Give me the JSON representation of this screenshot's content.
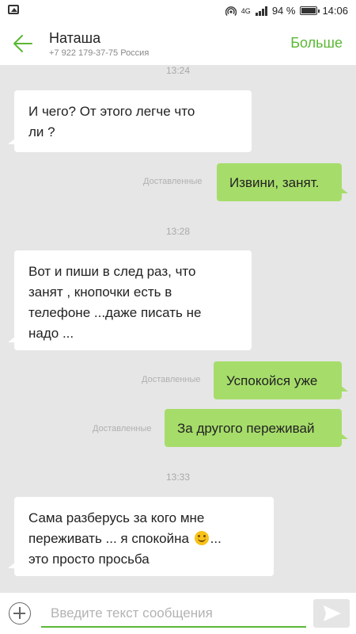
{
  "status_bar": {
    "network": "4G",
    "battery_text": "94 %",
    "time": "14:06"
  },
  "header": {
    "name": "Наташа",
    "subtitle": "+7 922 179-37-75 Россия",
    "more_label": "Больше"
  },
  "messages": [
    {
      "type": "time",
      "text": "13:24"
    },
    {
      "type": "incoming",
      "lines": [
        "И чего? От этого легче что",
        "ли ?"
      ]
    },
    {
      "type": "outgoing",
      "text": "Извини, занят.",
      "status": "Доставленные"
    },
    {
      "type": "time",
      "text": "13:28"
    },
    {
      "type": "incoming",
      "lines": [
        "Вот и пиши в след раз, что",
        "занят , кнопочки есть в",
        "телефоне ...даже писать не",
        "надо ..."
      ]
    },
    {
      "type": "outgoing",
      "text": "Успокойся уже",
      "status": "Доставленные"
    },
    {
      "type": "outgoing",
      "text": "За другого переживай",
      "status": "Доставленные"
    },
    {
      "type": "time",
      "text": "13:33"
    },
    {
      "type": "incoming",
      "lines": [
        "Сама разберусь за кого мне",
        "переживать ... я спокойна",
        "... ",
        "это просто просьба"
      ]
    }
  ],
  "composer": {
    "placeholder": "Введите текст сообщения"
  },
  "icons": {
    "status_left": "image-icon",
    "back": "back-arrow-icon",
    "attach": "add-circle-icon",
    "send": "send-icon",
    "emoji": "smiley-emoji"
  },
  "colors": {
    "accent": "#5bb834",
    "outgoing_bubble": "#a6dd6a",
    "incoming_bubble": "#ffffff",
    "background": "#e6e6e6"
  }
}
